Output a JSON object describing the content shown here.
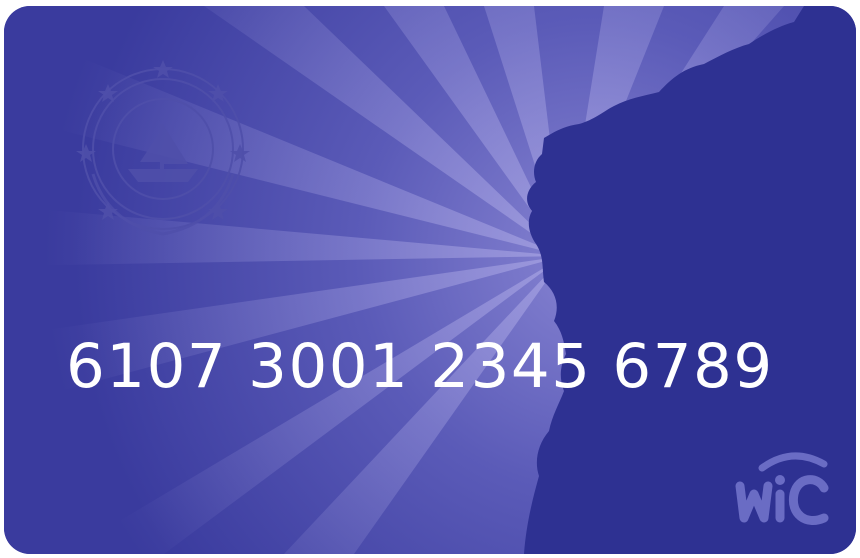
{
  "card": {
    "number": "6107 3001 2345 6789",
    "logo_text": "WIC",
    "seal": "state-seal-emblem",
    "colors": {
      "base": "#3a3b9e",
      "silhouette": "#2e3192",
      "ray": "#8a86d4",
      "number_text": "#ffffff",
      "logo": "#6a6cc4"
    }
  }
}
